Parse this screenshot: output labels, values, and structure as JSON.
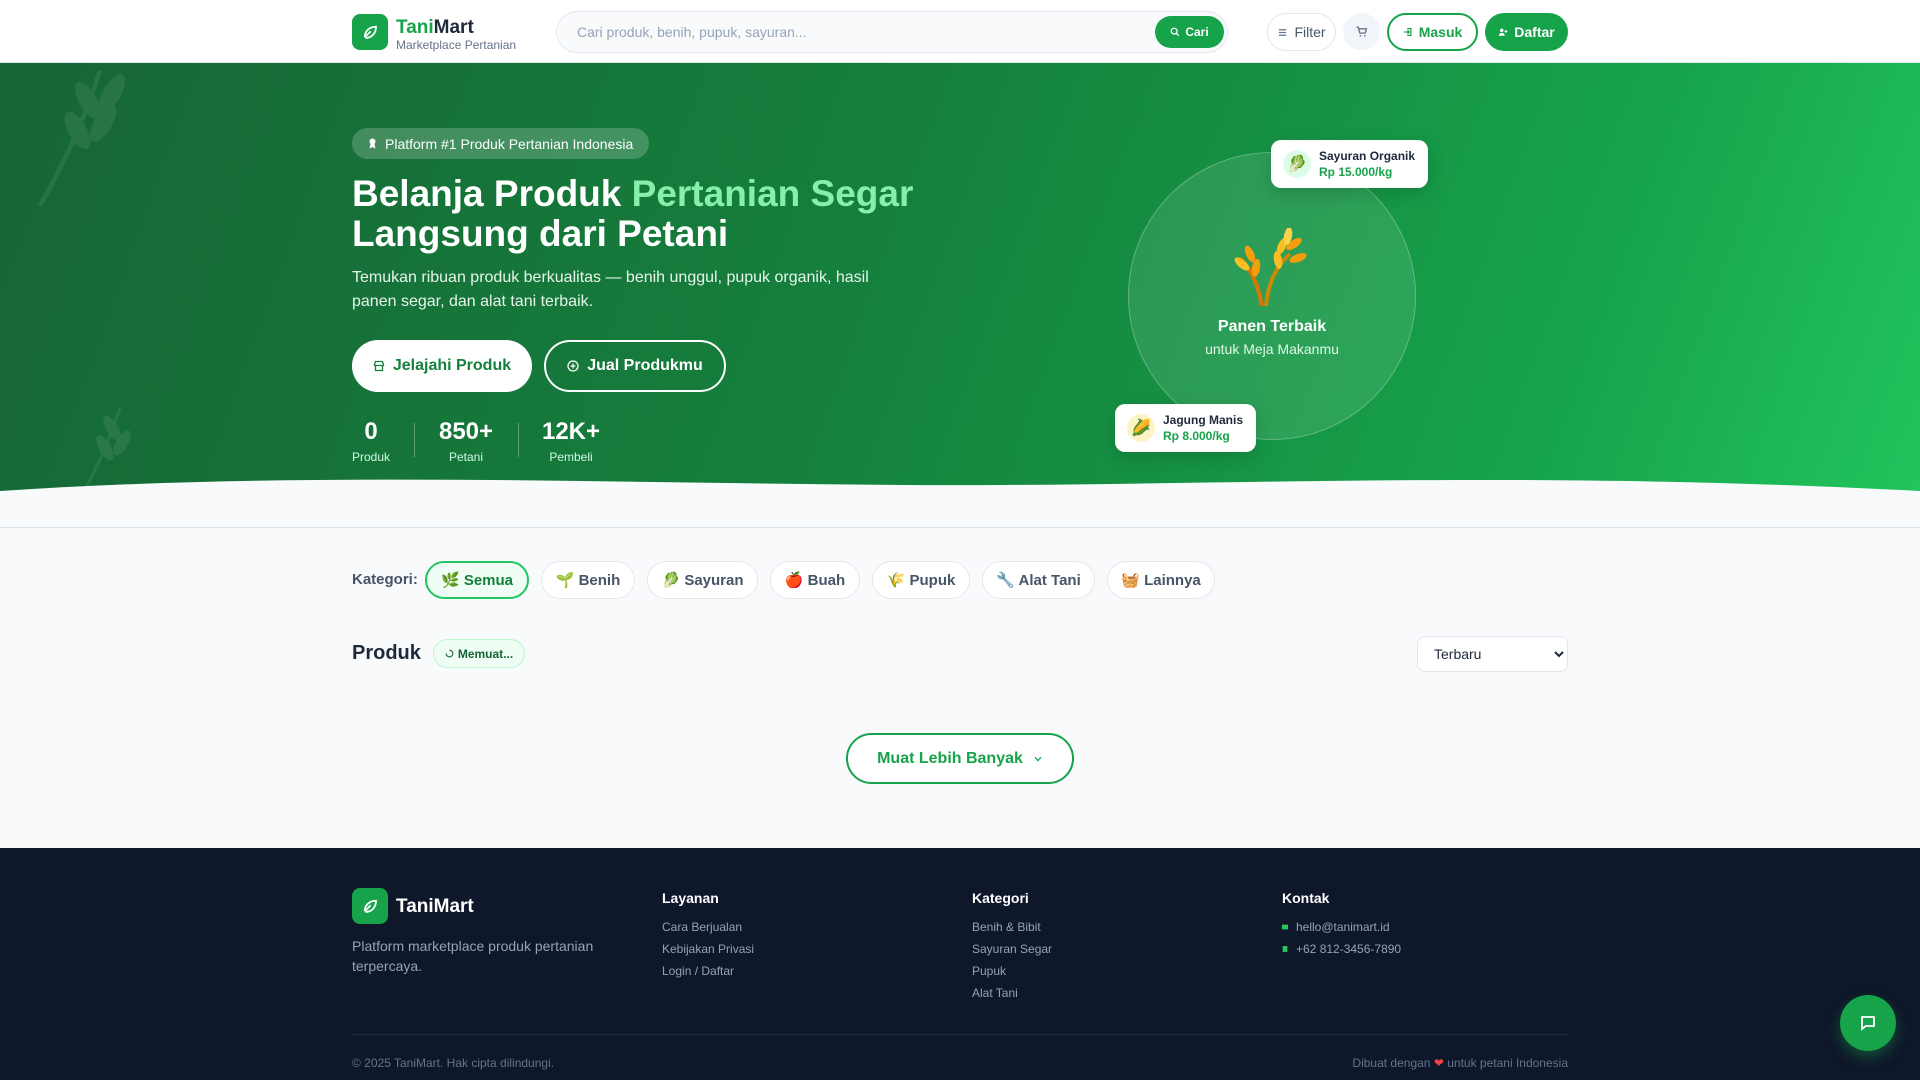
{
  "header": {
    "logo_icon": "leaf-icon",
    "brand_part1": "Tani",
    "brand_part2": "Mart",
    "brand_sub": "Marketplace Pertanian",
    "search_placeholder": "Cari produk, benih, pupuk, sayuran...",
    "search_button": "Cari",
    "filter_label": "Filter",
    "login_label": "Masuk",
    "register_label": "Daftar"
  },
  "hero": {
    "pill": "Platform #1 Produk Pertanian Indonesia",
    "title_part1": "Belanja Produk ",
    "title_highlight": "Pertanian Segar",
    "title_part2": "Langsung dari Petani",
    "description": "Temukan ribuan produk berkualitas — benih unggul, pupuk organik, hasil panen segar, dan alat tani terbaik.",
    "explore_button": "Jelajahi Produk",
    "sell_button": "Jual Produkmu",
    "stats": [
      {
        "value": "0",
        "label": "Produk"
      },
      {
        "value": "850+",
        "label": "Petani"
      },
      {
        "value": "12K+",
        "label": "Pembeli"
      }
    ],
    "circle_title": "Panen Terbaik",
    "circle_subtitle": "untuk Meja Makanmu",
    "card_top": {
      "name": "Sayuran Organik",
      "price": "Rp 15.000/kg",
      "icon": "🥬"
    },
    "card_bottom": {
      "name": "Jagung Manis",
      "price": "Rp 8.000/kg",
      "icon": "🌽"
    }
  },
  "categories": {
    "label": "Kategori:",
    "items": [
      "🌿 Semua",
      "🌱 Benih",
      "🥬 Sayuran",
      "🍎 Buah",
      "🌾 Pupuk",
      "🔧 Alat Tani",
      "🧺 Lainnya"
    ],
    "active": "🌿 Semua"
  },
  "products": {
    "title": "Produk",
    "loading": "Memuat...",
    "sort_selected": "Terbaru",
    "load_more": "Muat Lebih Banyak"
  },
  "footer": {
    "brand": "TaniMart",
    "description": "Platform marketplace produk pertanian terpercaya.",
    "services_title": "Layanan",
    "services": [
      "Cara Berjualan",
      "Kebijakan Privasi",
      "Login / Daftar"
    ],
    "category_title": "Kategori",
    "category_links": [
      "Benih & Bibit",
      "Sayuran Segar",
      "Pupuk",
      "Alat Tani"
    ],
    "contact_title": "Kontak",
    "email": "hello@tanimart.id",
    "phone": "+62 812-3456-7890",
    "copyright": "© 2025 TaniMart. Hak cipta dilindungi.",
    "made_prefix": "Dibuat dengan",
    "made_heart": "❤",
    "made_suffix": "untuk petani Indonesia"
  },
  "colors": {
    "primary": "#16a34a",
    "dark": "#0f172a",
    "highlight": "#86efac"
  }
}
